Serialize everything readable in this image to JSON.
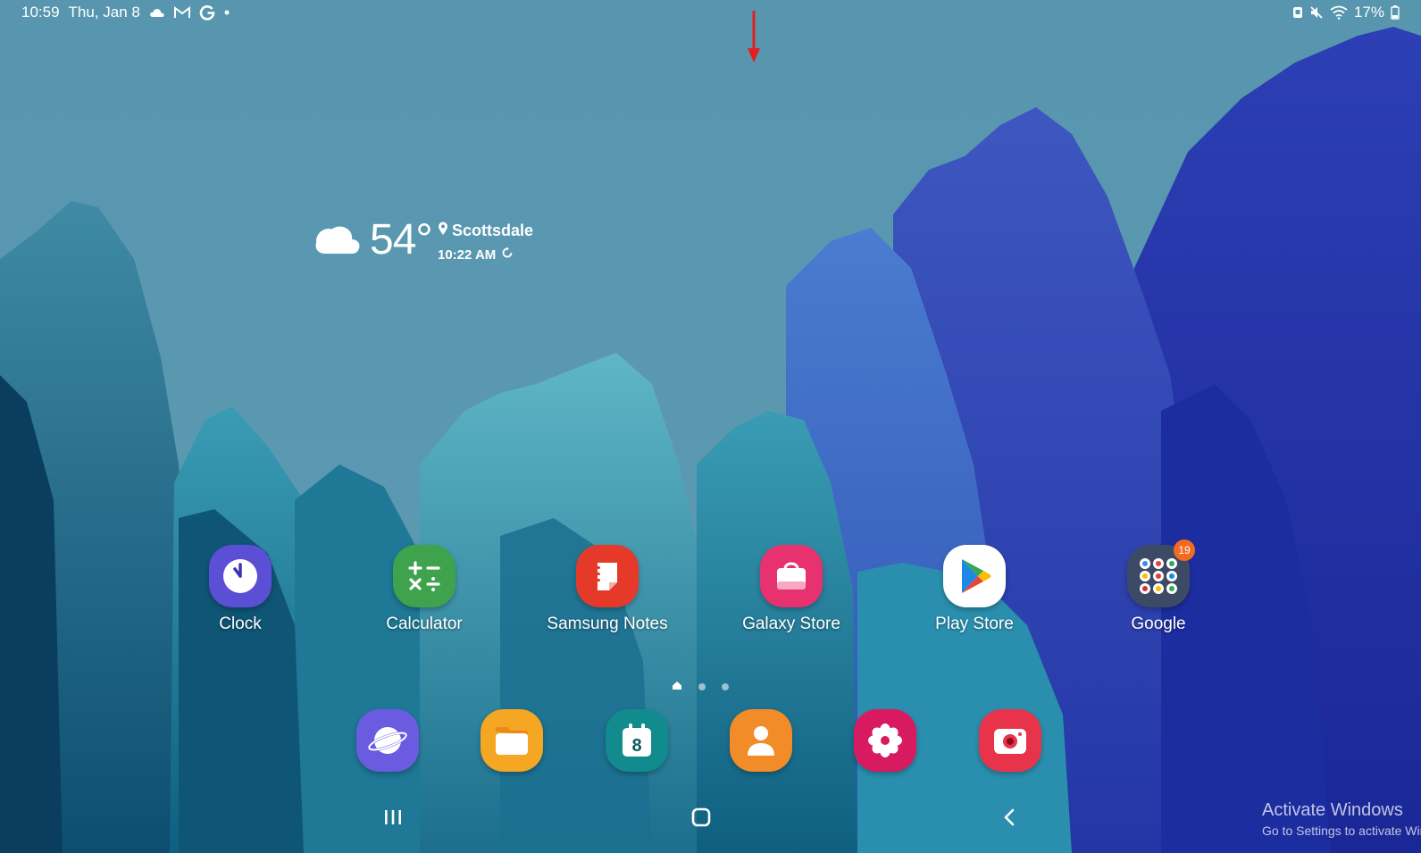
{
  "status_bar": {
    "time": "10:59",
    "date": "Thu, Jan 8",
    "left_icons": [
      "cloud-icon",
      "gmail-icon",
      "google-g-icon",
      "more-dot-icon"
    ],
    "right_icons": [
      "screenshot-icon",
      "mute-icon",
      "wifi-icon",
      "battery-icon"
    ],
    "battery": "17%"
  },
  "weather": {
    "icon": "cloud-icon",
    "temperature": "54°",
    "location": "Scottsdale",
    "updated": "10:22 AM"
  },
  "apps": [
    {
      "label": "Clock",
      "icon": "clock-icon",
      "color": "#5b4fd6"
    },
    {
      "label": "Calculator",
      "icon": "calculator-icon",
      "color": "#3fa34d"
    },
    {
      "label": "Samsung Notes",
      "icon": "samsung-notes-icon",
      "color": "#e53a2a"
    },
    {
      "label": "Galaxy Store",
      "icon": "galaxy-store-icon",
      "color": "#e8326f"
    },
    {
      "label": "Play Store",
      "icon": "play-store-icon",
      "color": "#ffffff"
    },
    {
      "label": "Google",
      "icon": "google-folder-icon",
      "color": "#3d4a66",
      "badge": "19"
    }
  ],
  "page_indicator": {
    "pages": 3,
    "current": 1
  },
  "dock": [
    {
      "icon": "internet-icon",
      "color": "#6a5be0"
    },
    {
      "icon": "my-files-icon",
      "color": "#f5a623"
    },
    {
      "icon": "calendar-icon",
      "color": "#128b8e",
      "text": "8"
    },
    {
      "icon": "contacts-icon",
      "color": "#f28c28"
    },
    {
      "icon": "gallery-icon",
      "color": "#d81b60"
    },
    {
      "icon": "camera-icon",
      "color": "#e8344a"
    }
  ],
  "nav_bar": [
    "recents-button",
    "home-button",
    "back-button"
  ],
  "watermark": {
    "line1": "Activate Windows",
    "line2": "Go to Settings to activate Windows."
  },
  "annotation": {
    "color": "#e02020"
  }
}
